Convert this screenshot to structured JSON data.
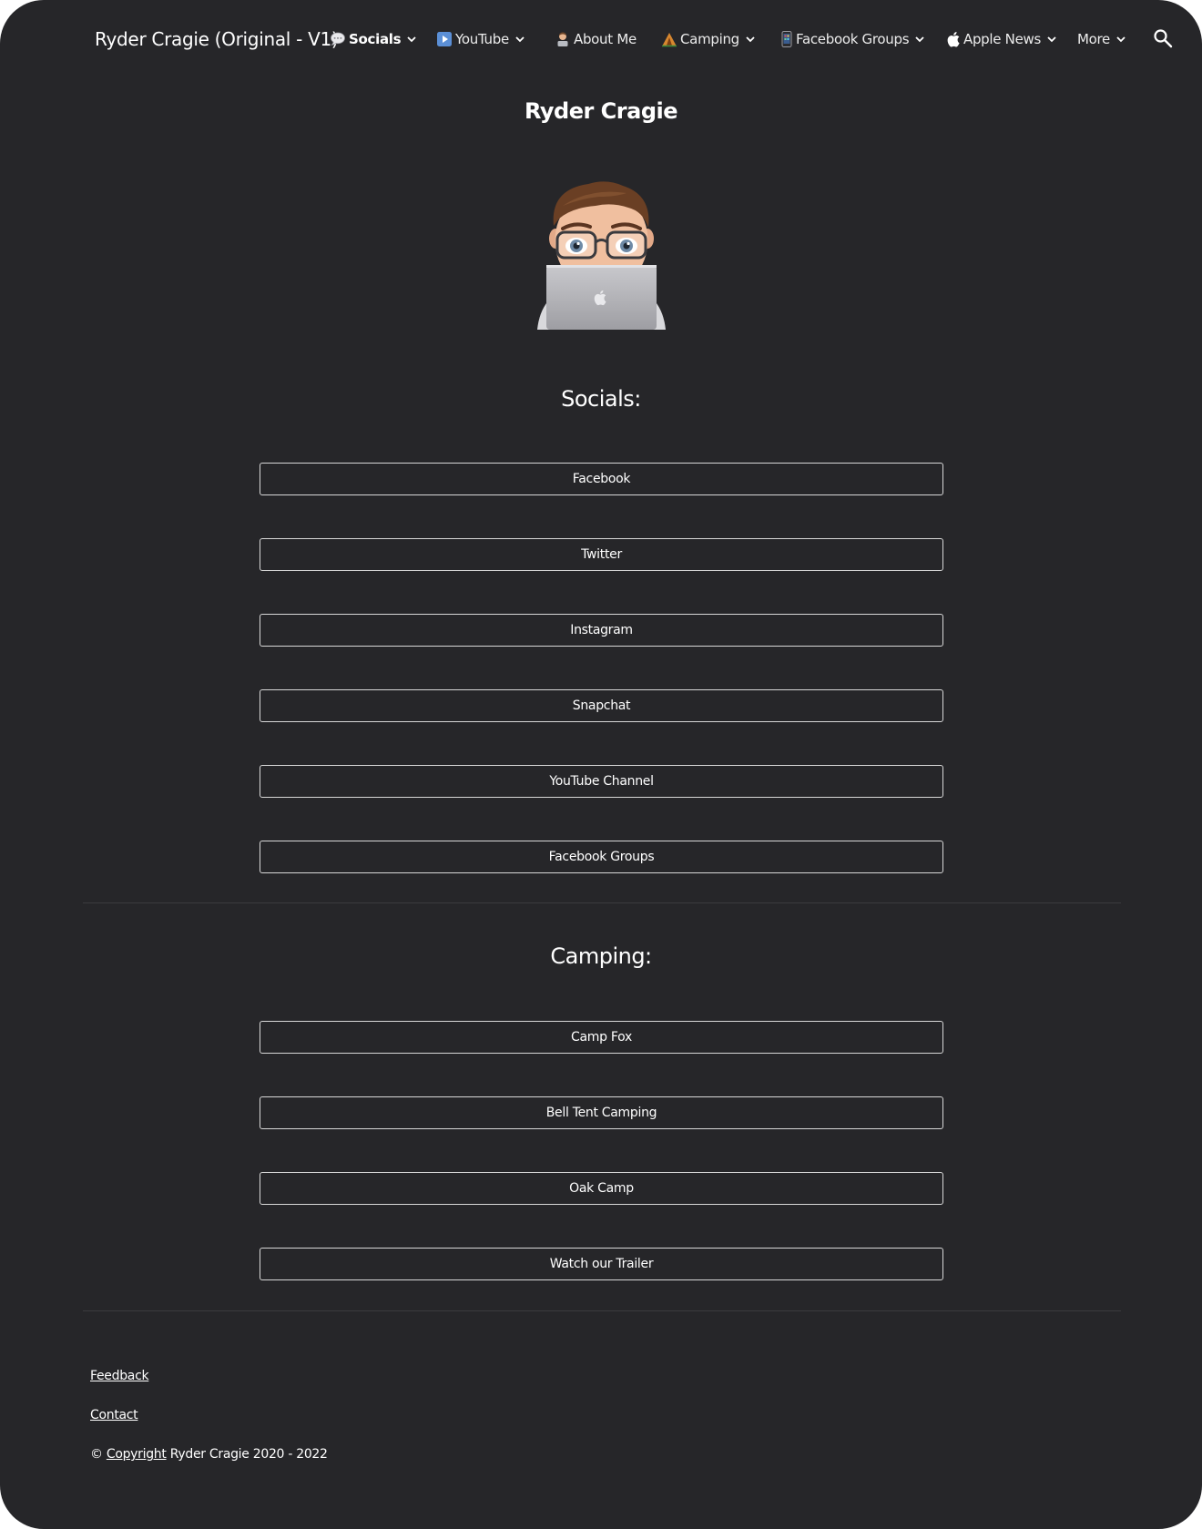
{
  "header": {
    "site_title": "Ryder Cragie (Original - V1)",
    "nav": [
      {
        "label": "Socials",
        "icon": "speech-bubble-icon",
        "has_dropdown": true,
        "active": true
      },
      {
        "label": "YouTube",
        "icon": "play-button-icon",
        "has_dropdown": true,
        "active": false
      },
      {
        "label": "About Me",
        "icon": "person-icon",
        "has_dropdown": false,
        "active": false
      },
      {
        "label": "Camping",
        "icon": "tent-icon",
        "has_dropdown": true,
        "active": false
      },
      {
        "label": "Facebook Groups",
        "icon": "phone-icon",
        "has_dropdown": true,
        "active": false
      },
      {
        "label": "Apple News",
        "icon": "apple-icon",
        "has_dropdown": true,
        "active": false
      },
      {
        "label": "More",
        "icon": "",
        "has_dropdown": true,
        "active": false
      }
    ],
    "search_icon": "search-icon"
  },
  "main": {
    "title": "Ryder Cragie",
    "avatar_icon": "memoji-laptop-avatar",
    "socials": {
      "heading": "Socials:",
      "buttons": [
        "Facebook",
        "Twitter",
        "Instagram",
        "Snapchat",
        "YouTube Channel",
        "Facebook Groups"
      ]
    },
    "camping": {
      "heading": "Camping:",
      "buttons": [
        "Camp Fox",
        "Bell Tent Camping",
        "Oak Camp",
        "Watch our Trailer"
      ]
    }
  },
  "footer": {
    "feedback": "Feedback",
    "contact": "Contact",
    "copyright_symbol": "©",
    "copyright_link": "Copyright",
    "copyright_text": "Ryder Cragie 2020 - 2022"
  },
  "colors": {
    "background": "#262629",
    "text": "#ffffff",
    "button_border": "#d8d8d8",
    "divider": "#3b3b3e"
  }
}
